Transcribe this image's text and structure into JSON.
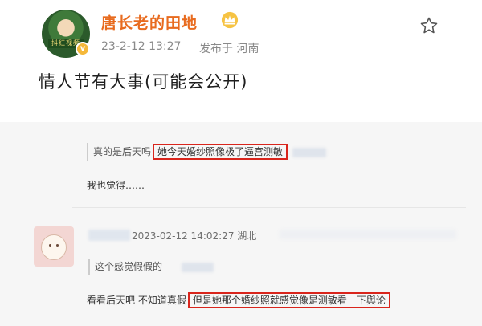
{
  "post": {
    "username": "唐长老的田地",
    "avatar_caption": "抖红视频",
    "timestamp": "23-2-12 13:27",
    "location": "发布于 河南",
    "text": "情人节有大事(可能会公开)",
    "icons": {
      "crown": "crown-icon",
      "verified": "verified-badge-icon",
      "favorite": "star-icon"
    },
    "colors": {
      "username": "#e86b1f",
      "highlight_border": "#d9251c"
    }
  },
  "comments": {
    "quote_1": {
      "prefix": "真的是后天吗",
      "highlight": "她今天婚纱照像极了逼宫测敏"
    },
    "reply_1": "我也觉得……",
    "comment_2": {
      "meta": "2023-02-12 14:02:27 湖北",
      "quote": "这个感觉假假的",
      "reply_prefix": "看看后天吧 不知道真假",
      "reply_highlight": "但是她那个婚纱照就感觉像是测敏看一下舆论"
    }
  }
}
